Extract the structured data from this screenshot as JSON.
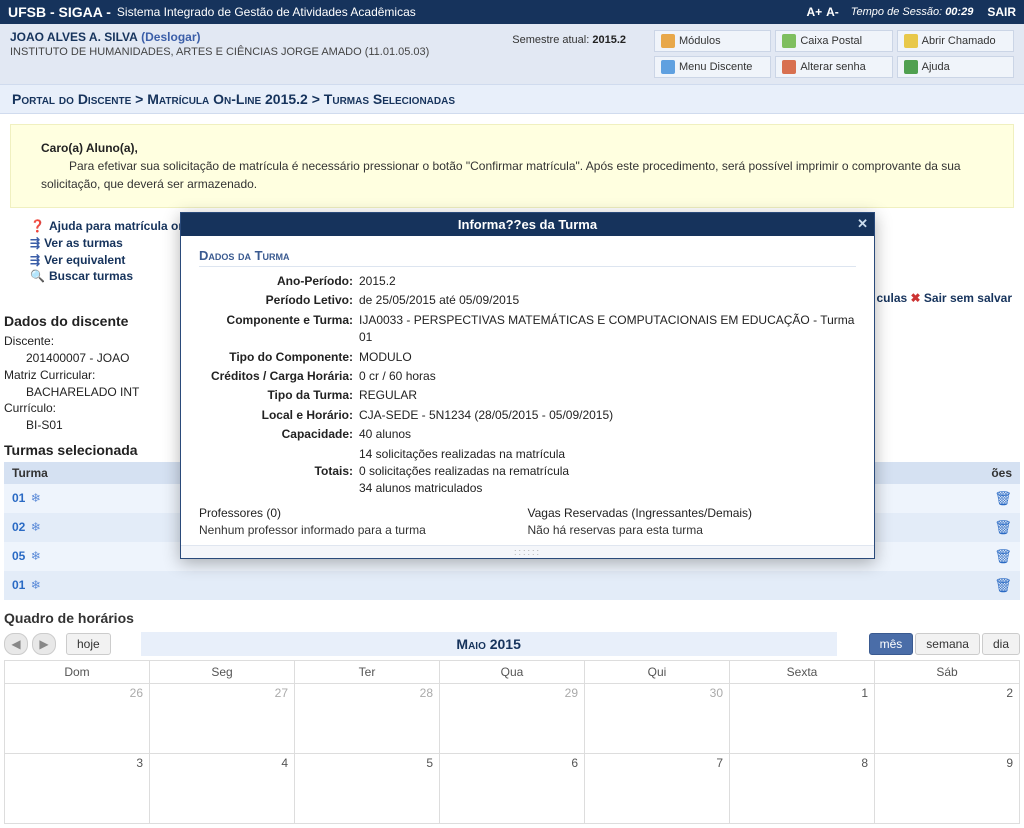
{
  "topbar": {
    "brand": "UFSB - SIGAA -",
    "subtitle": "Sistema Integrado de Gestão de Atividades Acadêmicas",
    "font_inc": "A+",
    "font_dec": "A-",
    "session_label": "Tempo de Sessão:",
    "session_time": "00:29",
    "logout": "SAIR"
  },
  "userbar": {
    "username": "JOAO ALVES A. SILVA",
    "logoff": "(Deslogar)",
    "dept": "INSTITUTO DE HUMANIDADES, ARTES E CIÊNCIAS JORGE AMADO (11.01.05.03)",
    "semester_label": "Semestre atual:",
    "semester_value": "2015.2"
  },
  "menu": {
    "modulos": "Módulos",
    "caixa": "Caixa Postal",
    "chamado": "Abrir Chamado",
    "menu_discente": "Menu Discente",
    "alterar_senha": "Alterar senha",
    "ajuda": "Ajuda"
  },
  "breadcrumb": "Portal do Discente > Matrícula On-Line 2015.2 > Turmas Selecionadas",
  "notice": {
    "salutation": "Caro(a) Aluno(a),",
    "body": "Para efetivar sua solicitação de matrícula é necessário pressionar o botão \"Confirmar matrícula\". Após este procedimento, será possível imprimir o comprovante da sua solicitação, que deverá ser armazenado."
  },
  "help_links": {
    "l1": "Ajuda para matrícula on-line",
    "l2": "Ver as turmas",
    "l3": "Ver equivalent",
    "l4": "Buscar turmas"
  },
  "right_links": {
    "culas": "culas",
    "sair": "Sair sem salvar"
  },
  "dados_discente": {
    "title": "Dados do discente",
    "discente_lbl": "Discente:",
    "discente_val": "201400007 - JOAO",
    "matriz_lbl": "Matriz Curricular:",
    "matriz_val": "BACHARELADO INT",
    "curriculo_lbl": "Currículo:",
    "curriculo_val": "BI-S01"
  },
  "turmas_sel": {
    "title": "Turmas selecionada",
    "col_turma": "Turma",
    "col_acoes": "ões",
    "rows": [
      {
        "num": "01"
      },
      {
        "num": "02"
      },
      {
        "num": "05"
      },
      {
        "num": "01"
      }
    ]
  },
  "schedule": {
    "title": "Quadro de horários",
    "today": "hoje",
    "month": "Maio 2015",
    "view_mes": "mês",
    "view_semana": "semana",
    "view_dia": "dia",
    "days": [
      "Dom",
      "Seg",
      "Ter",
      "Qua",
      "Qui",
      "Sexta",
      "Sáb"
    ],
    "week1": [
      "26",
      "27",
      "28",
      "29",
      "30",
      "1",
      "2"
    ],
    "week2": [
      "3",
      "4",
      "5",
      "6",
      "7",
      "8",
      "9"
    ]
  },
  "modal": {
    "title": "Informa??es da Turma",
    "section": "Dados da Turma",
    "fields": {
      "ano_periodo_l": "Ano-Período:",
      "ano_periodo_v": "2015.2",
      "periodo_letivo_l": "Período Letivo:",
      "periodo_letivo_v": "de 25/05/2015 até 05/09/2015",
      "componente_l": "Componente e Turma:",
      "componente_v": "IJA0033 - PERSPECTIVAS MATEMÁTICAS E COMPUTACIONAIS EM EDUCAÇÃO - Turma 01",
      "tipo_comp_l": "Tipo do Componente:",
      "tipo_comp_v": "MODULO",
      "creditos_l": "Créditos / Carga Horária:",
      "creditos_v": "0 cr / 60 horas",
      "tipo_turma_l": "Tipo da Turma:",
      "tipo_turma_v": "REGULAR",
      "local_l": "Local e Horário:",
      "local_v": "CJA-SEDE - 5N1234 (28/05/2015 - 05/09/2015)",
      "capacidade_l": "Capacidade:",
      "capacidade_v": "40 alunos",
      "totais_l": "Totais:",
      "totais_v1": "14 solicitações realizadas na matrícula",
      "totais_v2": "0 solicitações realizadas na rematrícula",
      "totais_v3": "34 alunos matriculados"
    },
    "professores_title": "Professores (0)",
    "professores_empty": "Nenhum professor informado para a turma",
    "vagas_title": "Vagas Reservadas (Ingressantes/Demais)",
    "vagas_empty": "Não há reservas para esta turma"
  }
}
